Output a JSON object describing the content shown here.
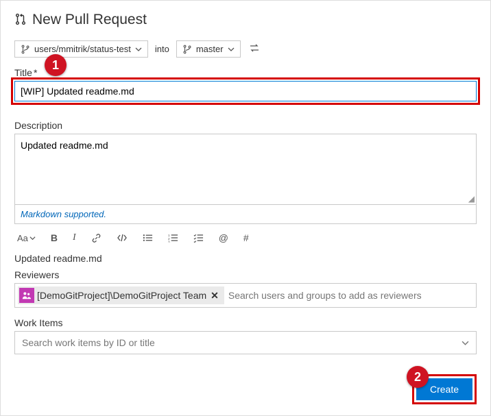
{
  "header": {
    "title": "New Pull Request"
  },
  "branches": {
    "source": "users/mmitrik/status-test",
    "into": "into",
    "target": "master"
  },
  "title": {
    "label": "Title",
    "required_marker": "*",
    "value": "[WIP] Updated readme.md"
  },
  "description": {
    "label": "Description",
    "value": "Updated readme.md",
    "markdown_hint": "Markdown supported."
  },
  "toolbar": {
    "text_size": "Aa",
    "bold": "B",
    "italic": "I",
    "at": "@",
    "hash": "#"
  },
  "preview": {
    "text": "Updated readme.md"
  },
  "reviewers": {
    "label": "Reviewers",
    "chip": "[DemoGitProject]\\DemoGitProject Team",
    "placeholder": "Search users and groups to add as reviewers"
  },
  "work_items": {
    "label": "Work Items",
    "placeholder": "Search work items by ID or title"
  },
  "actions": {
    "create": "Create"
  },
  "callouts": {
    "one": "1",
    "two": "2"
  }
}
